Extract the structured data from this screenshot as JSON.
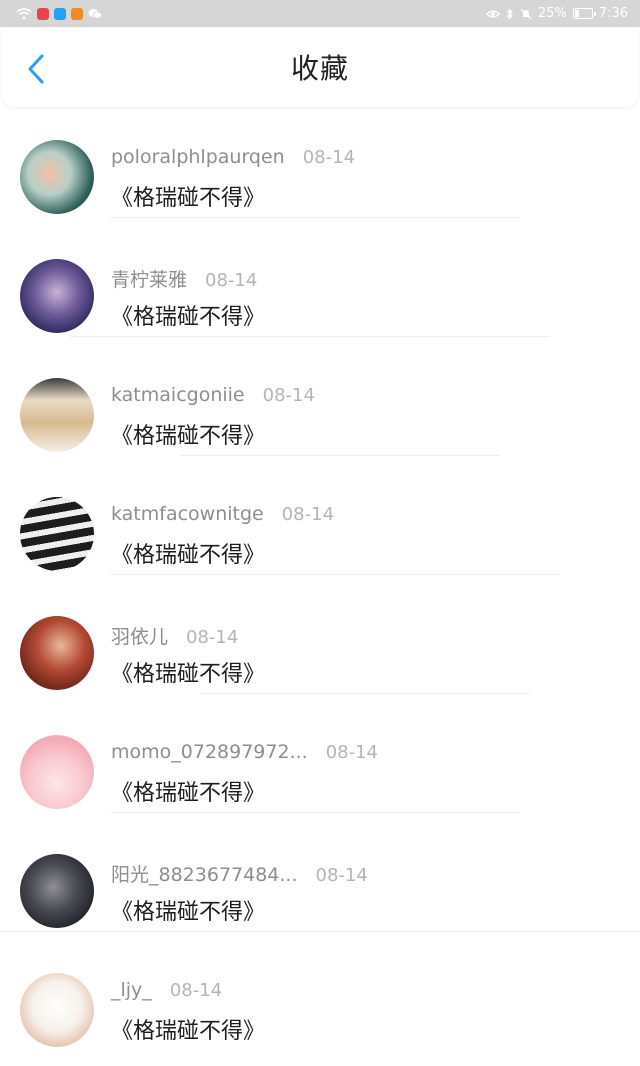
{
  "status_bar": {
    "battery": "25%",
    "time": "7:36"
  },
  "header": {
    "title": "收藏",
    "back_icon": "chevron-left-icon",
    "accent": "#2a9df4"
  },
  "items": [
    {
      "name": "poloralphlpaurqen",
      "date": "08-14",
      "content": "《格瑞碰不得》"
    },
    {
      "name": "青柠莱雅",
      "date": "08-14",
      "content": "《格瑞碰不得》"
    },
    {
      "name": "katmaicgoniie",
      "date": "08-14",
      "content": "《格瑞碰不得》"
    },
    {
      "name": "katmfacownitge",
      "date": "08-14",
      "content": "《格瑞碰不得》"
    },
    {
      "name": "羽依儿",
      "date": "08-14",
      "content": "《格瑞碰不得》"
    },
    {
      "name": "momo_072897972...",
      "date": "08-14",
      "content": "《格瑞碰不得》"
    },
    {
      "name": "阳光_8823677484...",
      "date": "08-14",
      "content": "《格瑞碰不得》"
    },
    {
      "name": "_ljy_",
      "date": "08-14",
      "content": "《格瑞碰不得》"
    }
  ]
}
